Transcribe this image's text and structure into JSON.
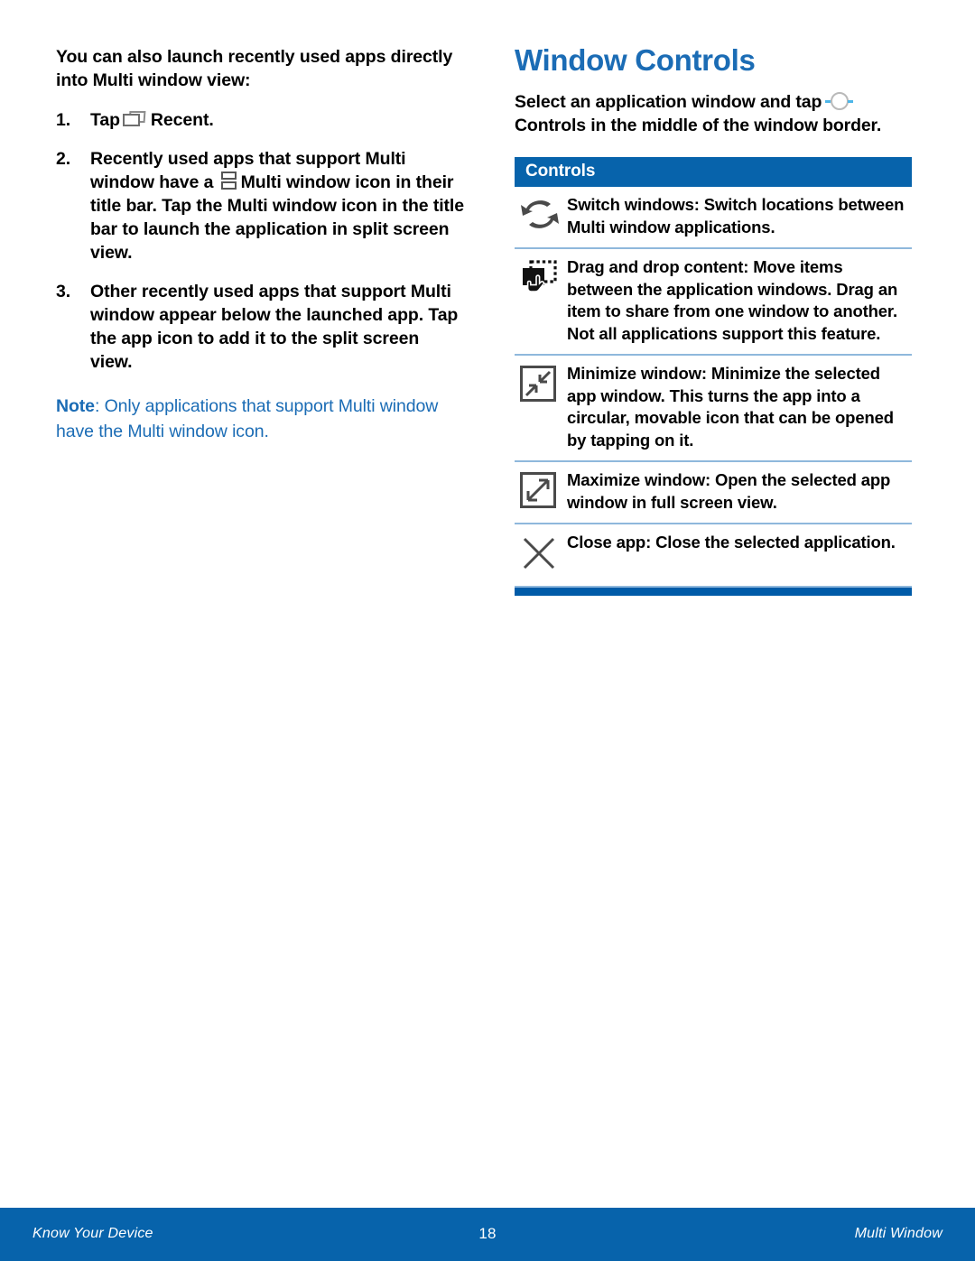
{
  "left_column": {
    "intro": "You can also launch recently used apps directly into Multi window view:",
    "steps": [
      {
        "number": "1.",
        "text_before_icon": "Tap",
        "icon": "recent-icon",
        "bold_label": "Recent",
        "text_after": "."
      },
      {
        "number": "2.",
        "text_before_icon": "Recently used apps that support Multi window have a",
        "icon": "multi-window-icon",
        "bold_label": "Multi window",
        "text_after": "icon in their title bar. Tap the Multi window icon in the title bar to launch the application in split screen view."
      },
      {
        "number": "3.",
        "text_before_icon": "Other recently used apps that support Multi window appear below the launched app. Tap the app icon to add it to the split screen view.",
        "icon": "",
        "bold_label": "",
        "text_after": ""
      }
    ],
    "note": {
      "label": "Note",
      "text": ": Only applications that support Multi window have the Multi window icon."
    }
  },
  "right_column": {
    "heading": "Window Controls",
    "intro_before_icon": "Select an application window and tap",
    "intro_icon": "controls-circle-icon",
    "intro_bold": "Controls",
    "intro_after": "in the middle of the window border.",
    "table": {
      "header": "Controls",
      "rows": [
        {
          "icon": "switch-windows-icon",
          "label": "Switch windows",
          "description": ": Switch locations between Multi window applications."
        },
        {
          "icon": "drag-drop-icon",
          "label": "Drag and drop content",
          "description": ": Move items between the application windows. Drag an item to share from one window to another. Not all applications support this feature."
        },
        {
          "icon": "minimize-window-icon",
          "label": "Minimize window",
          "description": ": Minimize the selected app window. This turns the app into a circular, movable icon that can be opened by tapping on it."
        },
        {
          "icon": "maximize-window-icon",
          "label": "Maximize window",
          "description": ": Open the selected app window in full screen view."
        },
        {
          "icon": "close-app-icon",
          "label": "Close app",
          "description": ": Close the selected application."
        }
      ]
    }
  },
  "footer": {
    "left": "Know Your Device",
    "page_number": "18",
    "right": "Multi Window"
  },
  "colors": {
    "brand_blue": "#0763ab",
    "heading_blue": "#1b6cb5",
    "rule_blue": "#8fb8dc",
    "bar_blue": "#005ba8",
    "icon_gray": "#4a4a4a"
  }
}
